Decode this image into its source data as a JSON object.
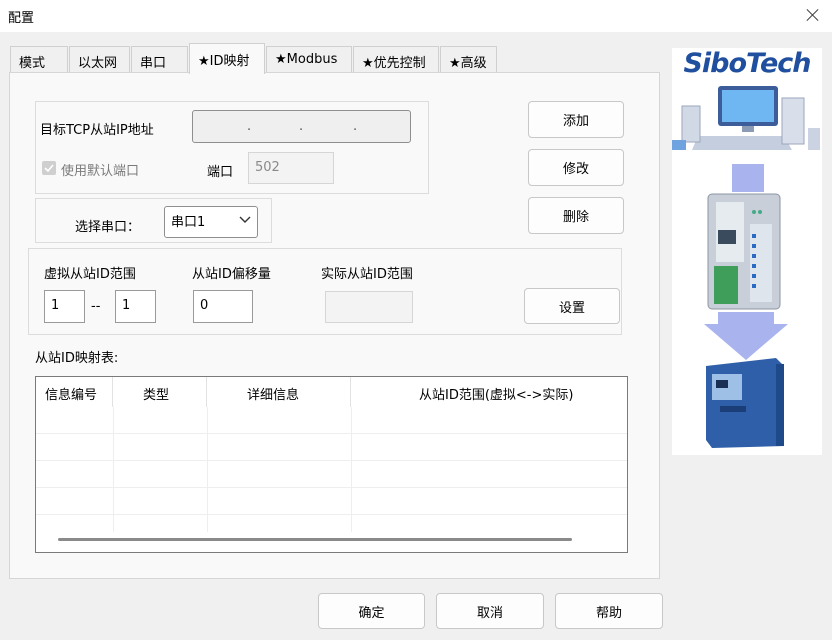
{
  "window": {
    "title": "配置"
  },
  "tabs": [
    {
      "label": "模式"
    },
    {
      "label": "以太网"
    },
    {
      "label": "串口"
    },
    {
      "label": "★ID映射"
    },
    {
      "label": "★Modbus"
    },
    {
      "label": "★优先控制"
    },
    {
      "label": "★高级"
    }
  ],
  "tcp": {
    "target_label": "目标TCP从站IP地址",
    "ip_separator": ".",
    "use_default_port_label": "使用默认端口",
    "port_label": "端口",
    "port_placeholder": "502"
  },
  "serial": {
    "select_label": "选择串口：",
    "selected": "串口1"
  },
  "id_range": {
    "virtual_label": "虚拟从站ID范围",
    "virtual_from": "1",
    "range_separator": "--",
    "virtual_to": "1",
    "offset_label": "从站ID偏移量",
    "offset_value": "0",
    "actual_label": "实际从站ID范围",
    "actual_value": ""
  },
  "buttons": {
    "add": "添加",
    "modify": "修改",
    "delete": "删除",
    "set": "设置",
    "ok": "确定",
    "cancel": "取消",
    "help": "帮助"
  },
  "table": {
    "title": "从站ID映射表:",
    "columns": [
      "信息编号",
      "类型",
      "详细信息",
      "从站ID范围(虚拟<->实际)"
    ]
  },
  "sidebar": {
    "brand": "SiboTech",
    "icons": [
      "computer-icon",
      "gateway-device-icon",
      "inverter-device-icon"
    ]
  },
  "colors": {
    "brand": "#1f4f9e",
    "arrow": "#a9b4ef",
    "panel_bg": "#f9f9f9",
    "window_bg": "#f0f0f0"
  }
}
